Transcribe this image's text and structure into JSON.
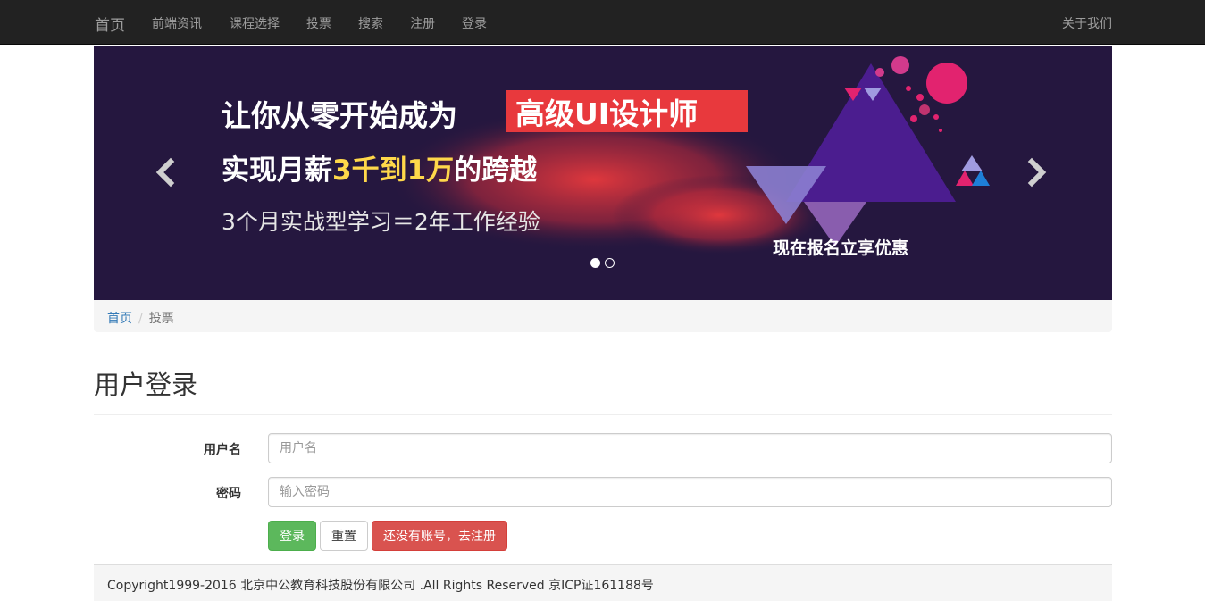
{
  "navbar": {
    "brand": "首页",
    "items": [
      "前端资讯",
      "课程选择",
      "投票",
      "搜索",
      "注册",
      "登录"
    ],
    "right_item": "关于我们"
  },
  "carousel": {
    "line1": "让你从零开始成为",
    "line1_highlight": "高级UI设计师",
    "line2_prefix": "实现月薪",
    "line2_highlight": "3千到1万",
    "line2_suffix": "的跨越",
    "line3": "3个月实战型学习＝2年工作经验",
    "cta": "现在报名立享优惠",
    "left_icon": "chevron-left-icon",
    "right_icon": "chevron-right-icon",
    "slide_count": 2,
    "active_slide": 1,
    "colors": {
      "background": "#25173f",
      "highlight_box": "#e8393d",
      "highlight_text": "#ffd84a",
      "triangle": "#4b1d8f"
    }
  },
  "breadcrumb": {
    "home": "首页",
    "separator": "/",
    "current": "投票"
  },
  "page": {
    "title": "用户登录"
  },
  "form": {
    "username_label": "用户名",
    "username_placeholder": "用户名",
    "username_value": "",
    "password_label": "密码",
    "password_placeholder": "输入密码",
    "password_value": "",
    "login_button": "登录",
    "reset_button": "重置",
    "register_button": "还没有账号，去注册"
  },
  "footer": {
    "text": "Copyright1999-2016 北京中公教育科技股份有限公司 .All Rights Reserved 京ICP证161188号"
  }
}
